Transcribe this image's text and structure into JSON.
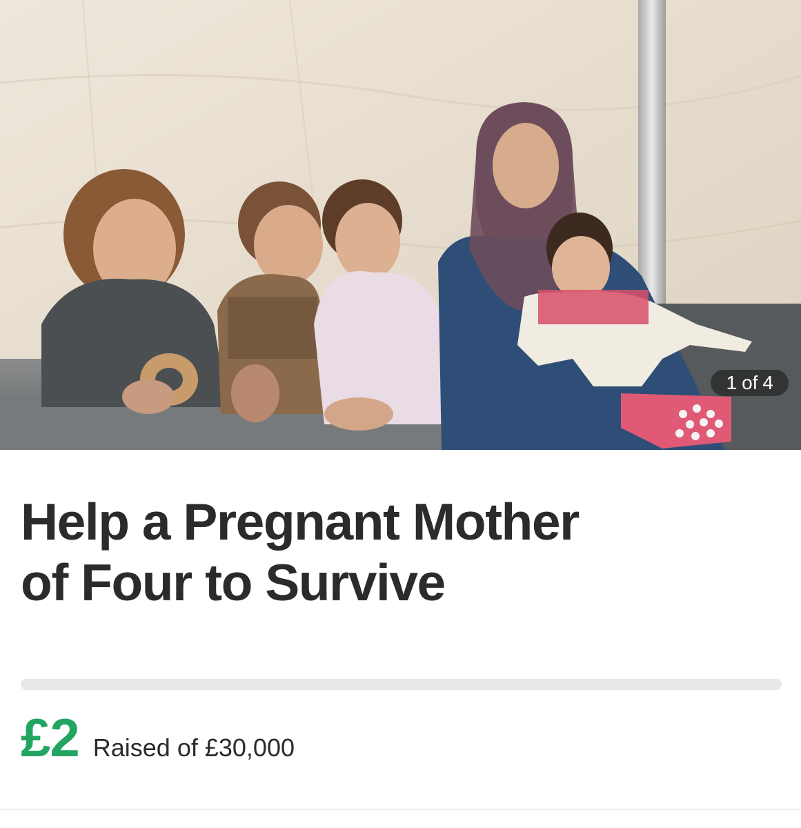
{
  "gallery": {
    "current": "1",
    "separator": "of",
    "total": "4"
  },
  "campaign": {
    "title_line1": "Help a Pregnant Mother",
    "title_line2": "of Four to Survive"
  },
  "funding": {
    "raised": "£2",
    "raised_label": "Raised of £30,000",
    "progress_fraction": 6.67e-05
  },
  "colors": {
    "accent_green": "#22a561",
    "title_text": "#2b2b2b"
  }
}
